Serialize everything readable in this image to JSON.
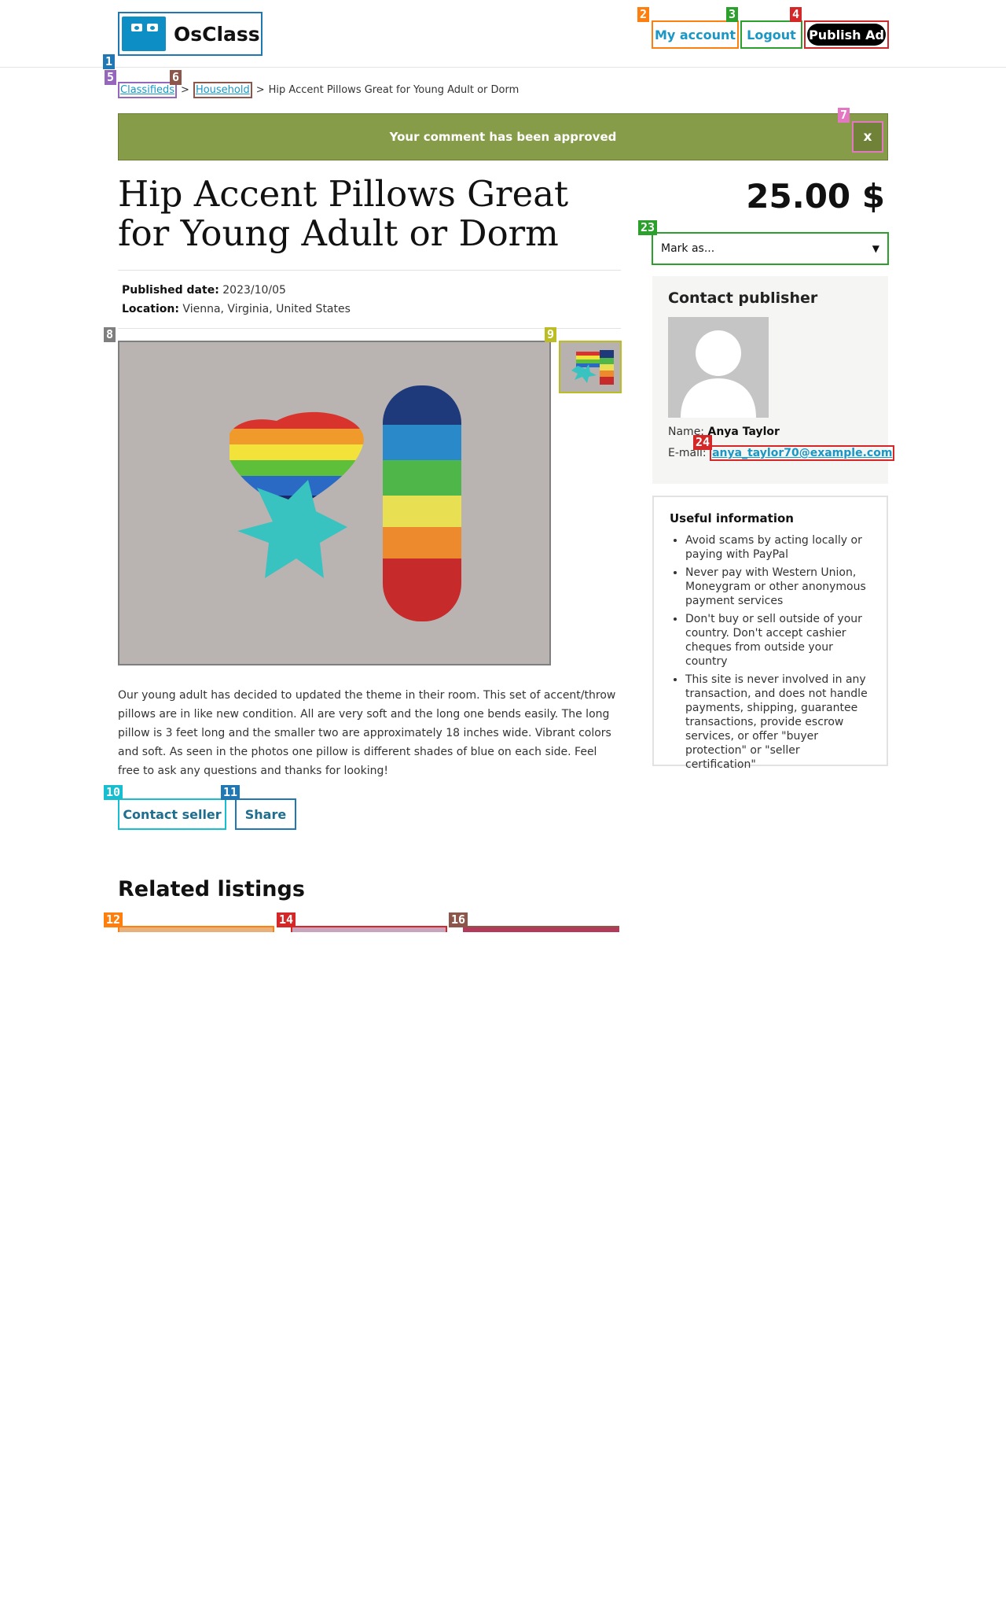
{
  "header": {
    "logo_text": "OsClass",
    "my_account": "My account",
    "logout": "Logout",
    "publish_ad": "Publish Ad"
  },
  "breadcrumb": {
    "items": [
      "Classifieds",
      "Household"
    ],
    "separator": ">",
    "current": "Hip Accent Pillows Great for Young Adult or Dorm"
  },
  "flash": {
    "message": "Your comment has been approved",
    "close": "x"
  },
  "listing": {
    "title": "Hip Accent Pillows Great for Young Adult or Dorm",
    "published_label": "Published date:",
    "published_value": "2023/10/05",
    "location_label": "Location:",
    "location_value": "Vienna, Virginia, United States",
    "description": "Our young adult has decided to updated the theme in their room. This set of accent/throw pillows are in like new condition. All are very soft and the long one bends easily. The long pillow is 3 feet long and the smaller two are approximately 18 inches wide. Vibrant colors and soft. As seen in the photos one pillow is different shades of blue on each side. Feel free to ask any questions and thanks for looking!",
    "contact_seller": "Contact seller",
    "share": "Share",
    "price": "25.00 $",
    "mark_as": "Mark as..."
  },
  "related": {
    "title": "Related listings"
  },
  "contact": {
    "title": "Contact publisher",
    "name_label": "Name:",
    "name_value": "Anya Taylor",
    "email_label": "E-mail:",
    "email_value": "anya_taylor70@example.com"
  },
  "useful": {
    "title": "Useful information",
    "items": [
      "Avoid scams by acting locally or paying with PayPal",
      "Never pay with Western Union, Moneygram or other anonymous payment services",
      "Don't buy or sell outside of your country. Don't accept cashier cheques from outside your country",
      "This site is never involved in any transaction, and does not handle payments, shipping, guarantee transactions, provide escrow services, or offer \"buyer protection\" or \"seller certification\""
    ]
  },
  "marks": [
    "1",
    "2",
    "3",
    "4",
    "5",
    "6",
    "7",
    "8",
    "9",
    "10",
    "11",
    "12",
    "14",
    "16",
    "23",
    "24"
  ],
  "colors": {
    "accent": "#1a97c4",
    "flash_bg": "#879c48",
    "publish_bg": "#000000"
  }
}
